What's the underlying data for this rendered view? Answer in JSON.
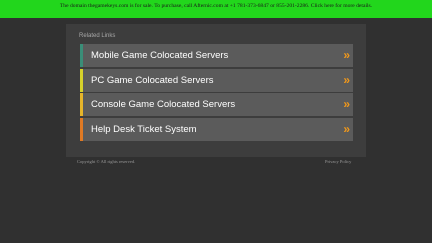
{
  "banner": {
    "text": "The domain thegamekeys.com is for sale. To purchase, call Afternic.com at +1 781-373-6847 or 855-201-2286. Click here for more details."
  },
  "related": {
    "title": "Related Links",
    "links": [
      {
        "label": "Mobile Game Colocated Servers",
        "color": "#3a8e78",
        "arrow": "»"
      },
      {
        "label": "PC Game Colocated Servers",
        "color": "#d6d12a",
        "arrow": "»"
      },
      {
        "label": "Console Game Colocated Servers",
        "color": "#e6b52a",
        "arrow": "»"
      },
      {
        "label": "Help Desk Ticket System",
        "color": "#e07a24",
        "arrow": "»"
      }
    ]
  },
  "footer": {
    "copyright": "Copyright ©   All rights reserved.",
    "privacy": "Privacy Policy"
  }
}
